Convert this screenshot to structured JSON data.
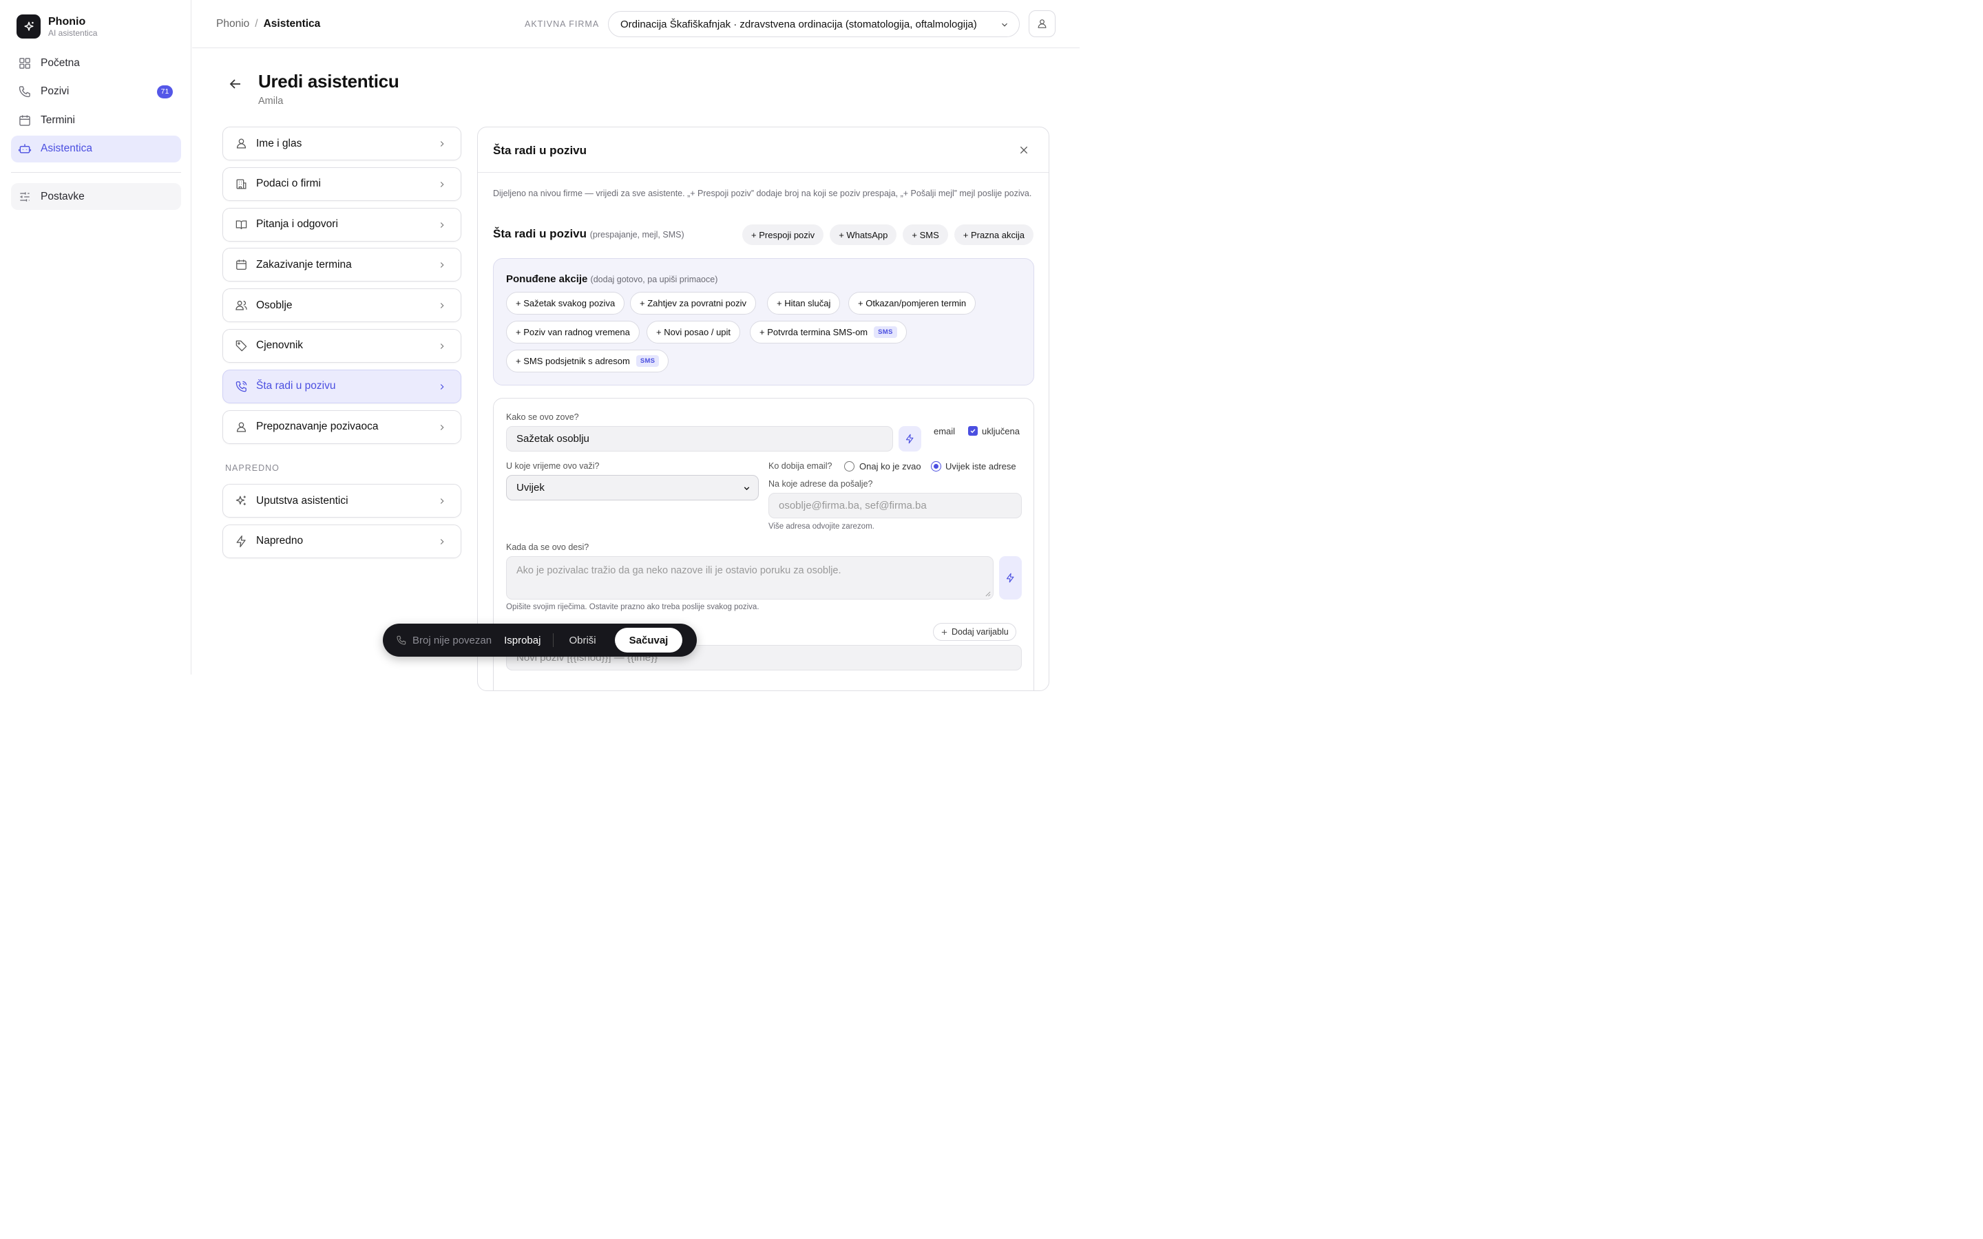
{
  "brand": {
    "name": "Phonio",
    "subtitle": "AI asistentica"
  },
  "sidebar": {
    "items": [
      {
        "label": "Početna",
        "icon": "grid-icon"
      },
      {
        "label": "Pozivi",
        "icon": "phone-icon",
        "badge": "71"
      },
      {
        "label": "Termini",
        "icon": "calendar-icon"
      },
      {
        "label": "Asistentica",
        "icon": "bot-icon",
        "active": true
      }
    ],
    "settings": {
      "label": "Postavke",
      "icon": "sliders-icon"
    }
  },
  "topbar": {
    "breadcrumb": [
      "Phonio",
      "Asistentica"
    ],
    "firm_label": "AKTIVNA FIRMA",
    "firm_value": "Ordinacija Škafiškafnjak · zdravstvena ordinacija (stomatologija, oftalmologija)"
  },
  "page": {
    "title": "Uredi asistenticu",
    "subtitle": "Amila"
  },
  "sections": [
    {
      "label": "Ime i glas",
      "icon": "user-icon"
    },
    {
      "label": "Podaci o firmi",
      "icon": "building-icon"
    },
    {
      "label": "Pitanja i odgovori",
      "icon": "book-icon"
    },
    {
      "label": "Zakazivanje termina",
      "icon": "calendar-icon"
    },
    {
      "label": "Osoblje",
      "icon": "users-icon"
    },
    {
      "label": "Cjenovnik",
      "icon": "tag-icon"
    },
    {
      "label": "Šta radi u pozivu",
      "icon": "phone-call-icon",
      "active": true
    },
    {
      "label": "Prepoznavanje pozivaoca",
      "icon": "user-icon"
    }
  ],
  "advanced": {
    "label": "NAPREDNO",
    "items": [
      {
        "label": "Uputstva asistentici",
        "icon": "sparkles-icon"
      },
      {
        "label": "Napredno",
        "icon": "bolt-icon"
      }
    ]
  },
  "panel": {
    "title": "Šta radi u pozivu",
    "description": "Dijeljeno na nivou firme — vrijedi za sve asistente. „+ Prespoji poziv” dodaje broj na koji se poziv prespaja, „+ Pošalji mejl” mejl poslije poziva.",
    "row_title": "Šta radi u pozivu",
    "row_hint": "(prespajanje, mejl, SMS)",
    "quick_actions": [
      "+ Prespoji poziv",
      "+ WhatsApp",
      "+ SMS",
      "+ Prazna akcija"
    ],
    "offered": {
      "title": "Ponuđene akcije",
      "hint": "(dodaj gotovo, pa upiši primaoce)",
      "chips": [
        {
          "label": "+ Sažetak svakog poziva"
        },
        {
          "label": "+ Zahtjev za povratni poziv"
        },
        {
          "label": "+ Hitan slučaj"
        },
        {
          "label": "+ Otkazan/pomjeren termin"
        },
        {
          "label": "+ Poziv van radnog vremena"
        },
        {
          "label": "+ Novi posao / upit"
        },
        {
          "label": "+ Potvrda termina SMS-om",
          "tag": "SMS"
        },
        {
          "label": "+ SMS podsjetnik s adresom",
          "tag": "SMS"
        }
      ]
    },
    "form": {
      "name_label": "Kako se ovo zove?",
      "name_value": "Sažetak osoblju",
      "type_label": "email",
      "enabled_label": "uključena",
      "when_label": "U koje vrijeme ovo važi?",
      "when_value": "Uvijek",
      "who_label": "Ko dobija email?",
      "who_option1": "Onaj ko je zvao",
      "who_option2": "Uvijek iste adrese",
      "addr_label": "Na koje adrese da pošalje?",
      "addr_placeholder": "osoblje@firma.ba, sef@firma.ba",
      "addr_help": "Više adresa odvojite zarezom.",
      "trigger_label": "Kada da se ovo desi?",
      "trigger_placeholder": "Ako je pozivalac tražio da ga neko nazove ili je ostavio poruku za osoblje.",
      "trigger_help": "Opišite svojim riječima. Ostavite prazno ako treba poslije svakog poziva.",
      "add_variable": "Dodaj varijablu",
      "subject_placeholder": "Novi poziv [{{ishod}}] — {{ime}}"
    }
  },
  "actionbar": {
    "phone_status": "Broj nije povezan",
    "try": "Isprobaj",
    "delete": "Obriši",
    "save": "Sačuvaj"
  },
  "colors": {
    "accent": "#4b4fe0",
    "accent_bg": "#e9eafd",
    "dark": "#17171c"
  }
}
